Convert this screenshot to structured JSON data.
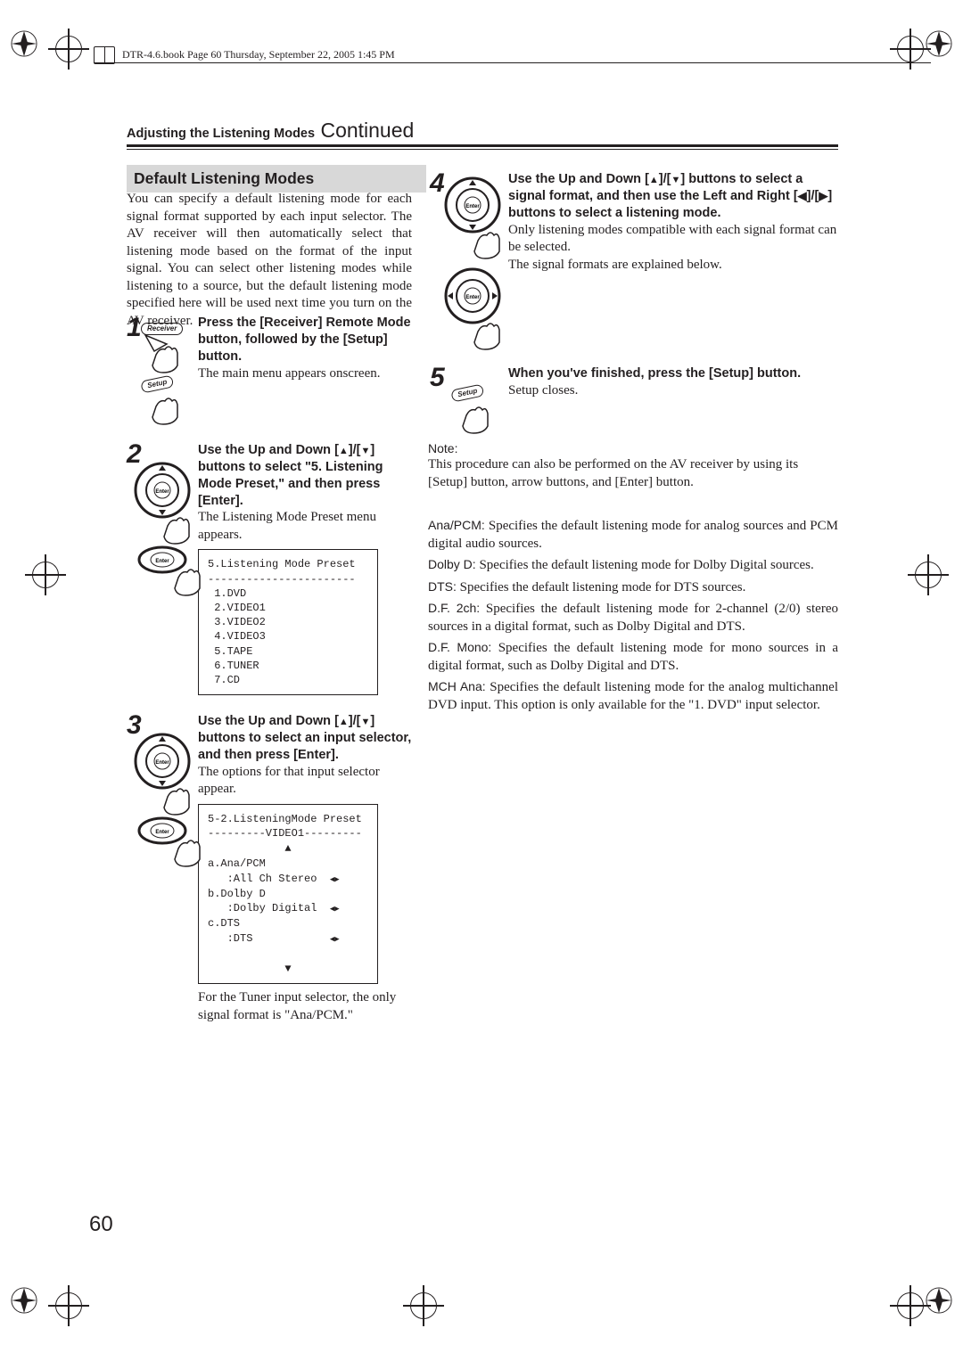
{
  "docHeader": "DTR-4.6.book  Page 60  Thursday, September 22, 2005  1:45 PM",
  "pageTitleBold": "Adjusting the Listening Modes",
  "pageTitleCont": " Continued",
  "sectionTitle": "Default Listening Modes",
  "intro": "You can specify a default listening mode for each signal format supported by each input selector. The AV receiver will then automatically select that listening mode based on the format of the input signal. You can select other listening modes while listening to a source, but the default listening mode specified here will be used next time you turn on the AV receiver.",
  "step1": {
    "bold": "Press the [Receiver] Remote Mode button, followed by the [Setup] button.",
    "body": "The main menu appears onscreen.",
    "pillReceiver": "Receiver",
    "pillSetup": "Setup"
  },
  "step2": {
    "bold_a": "Use the Up and Down [",
    "bold_b": "]/[",
    "bold_c": "] buttons to select \"5. Listening Mode Preset,\" and then press [Enter].",
    "body": "The Listening Mode Preset menu appears.",
    "screen": "5.Listening Mode Preset\n-----------------------\n 1.DVD\n 2.VIDEO1\n 3.VIDEO2\n 4.VIDEO3\n 5.TAPE\n 6.TUNER\n 7.CD",
    "pillEnter": "Enter"
  },
  "step3": {
    "bold_a": "Use the Up and Down [",
    "bold_b": "]/[",
    "bold_c": "] buttons to select an input selector, and then press [Enter].",
    "body": "The options for that input selector appear.",
    "footnote": "For the Tuner input selector, the only signal format is \"Ana/PCM.\"",
    "screen_header": "5-2.ListeningMode Preset",
    "screen_sub": "---------VIDEO1---------",
    "screen_a": "a.Ana/PCM",
    "screen_a_val": "   :All Ch Stereo",
    "screen_b": "b.Dolby D",
    "screen_b_val": "   :Dolby Digital",
    "screen_c": "c.DTS",
    "screen_c_val": "   :DTS",
    "pillEnter": "Enter"
  },
  "step4": {
    "bold_a": "Use the Up and Down [",
    "bold_b": "]/[",
    "bold_c": "] buttons to select a signal format, and then use the Left and Right [",
    "bold_d": "]/[",
    "bold_e": "] buttons to select a listening mode.",
    "body1": "Only listening modes compatible with each signal format can be selected.",
    "body2": "The signal formats are explained below.",
    "pillEnter": "Enter"
  },
  "step5": {
    "bold": "When you've finished, press the [Setup] button.",
    "body": "Setup closes.",
    "pillSetup": "Setup"
  },
  "noteLabel": "Note:",
  "noteBody": "This procedure can also be performed on the AV receiver by using its [Setup] button, arrow buttons, and [Enter] button.",
  "defs": {
    "ana_t": "Ana/PCM:",
    "ana_b": " Specifies the default listening mode for analog sources and PCM digital audio sources.",
    "dolby_t": "Dolby D:",
    "dolby_b": " Specifies the default listening mode for Dolby Digital sources.",
    "dts_t": "DTS:",
    "dts_b": " Specifies the default listening mode for DTS sources.",
    "df2_t": "D.F. 2ch:",
    "df2_b": " Specifies the default listening mode for 2-channel (2/0) stereo sources in a digital format, such as Dolby Digital and DTS.",
    "dfm_t": "D.F. Mono:",
    "dfm_b": " Specifies the default listening mode for mono sources in a digital format, such as Dolby Digital and DTS.",
    "mch_t": "MCH Ana:",
    "mch_b": " Specifies the default listening mode for the analog multichannel DVD input. This option is only available for the \"1. DVD\" input selector."
  },
  "pageNum": "60"
}
